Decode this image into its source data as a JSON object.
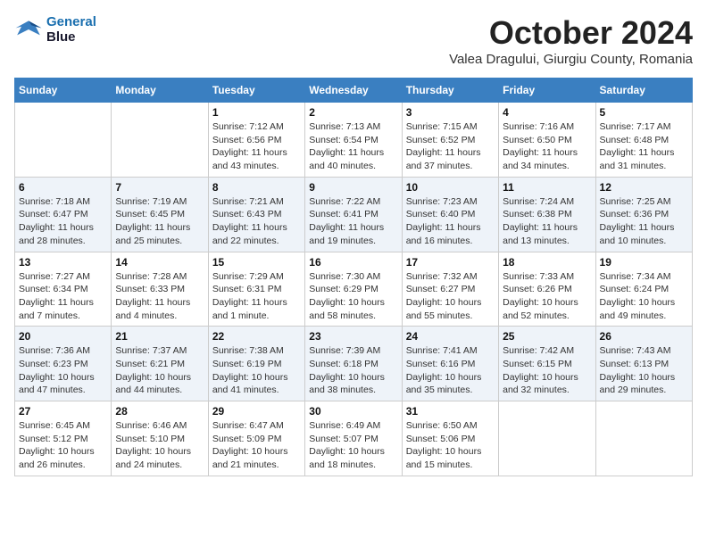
{
  "header": {
    "logo_line1": "General",
    "logo_line2": "Blue",
    "month": "October 2024",
    "location": "Valea Dragului, Giurgiu County, Romania"
  },
  "weekdays": [
    "Sunday",
    "Monday",
    "Tuesday",
    "Wednesday",
    "Thursday",
    "Friday",
    "Saturday"
  ],
  "weeks": [
    [
      {
        "day": "",
        "sunrise": "",
        "sunset": "",
        "daylight": ""
      },
      {
        "day": "",
        "sunrise": "",
        "sunset": "",
        "daylight": ""
      },
      {
        "day": "1",
        "sunrise": "Sunrise: 7:12 AM",
        "sunset": "Sunset: 6:56 PM",
        "daylight": "Daylight: 11 hours and 43 minutes."
      },
      {
        "day": "2",
        "sunrise": "Sunrise: 7:13 AM",
        "sunset": "Sunset: 6:54 PM",
        "daylight": "Daylight: 11 hours and 40 minutes."
      },
      {
        "day": "3",
        "sunrise": "Sunrise: 7:15 AM",
        "sunset": "Sunset: 6:52 PM",
        "daylight": "Daylight: 11 hours and 37 minutes."
      },
      {
        "day": "4",
        "sunrise": "Sunrise: 7:16 AM",
        "sunset": "Sunset: 6:50 PM",
        "daylight": "Daylight: 11 hours and 34 minutes."
      },
      {
        "day": "5",
        "sunrise": "Sunrise: 7:17 AM",
        "sunset": "Sunset: 6:48 PM",
        "daylight": "Daylight: 11 hours and 31 minutes."
      }
    ],
    [
      {
        "day": "6",
        "sunrise": "Sunrise: 7:18 AM",
        "sunset": "Sunset: 6:47 PM",
        "daylight": "Daylight: 11 hours and 28 minutes."
      },
      {
        "day": "7",
        "sunrise": "Sunrise: 7:19 AM",
        "sunset": "Sunset: 6:45 PM",
        "daylight": "Daylight: 11 hours and 25 minutes."
      },
      {
        "day": "8",
        "sunrise": "Sunrise: 7:21 AM",
        "sunset": "Sunset: 6:43 PM",
        "daylight": "Daylight: 11 hours and 22 minutes."
      },
      {
        "day": "9",
        "sunrise": "Sunrise: 7:22 AM",
        "sunset": "Sunset: 6:41 PM",
        "daylight": "Daylight: 11 hours and 19 minutes."
      },
      {
        "day": "10",
        "sunrise": "Sunrise: 7:23 AM",
        "sunset": "Sunset: 6:40 PM",
        "daylight": "Daylight: 11 hours and 16 minutes."
      },
      {
        "day": "11",
        "sunrise": "Sunrise: 7:24 AM",
        "sunset": "Sunset: 6:38 PM",
        "daylight": "Daylight: 11 hours and 13 minutes."
      },
      {
        "day": "12",
        "sunrise": "Sunrise: 7:25 AM",
        "sunset": "Sunset: 6:36 PM",
        "daylight": "Daylight: 11 hours and 10 minutes."
      }
    ],
    [
      {
        "day": "13",
        "sunrise": "Sunrise: 7:27 AM",
        "sunset": "Sunset: 6:34 PM",
        "daylight": "Daylight: 11 hours and 7 minutes."
      },
      {
        "day": "14",
        "sunrise": "Sunrise: 7:28 AM",
        "sunset": "Sunset: 6:33 PM",
        "daylight": "Daylight: 11 hours and 4 minutes."
      },
      {
        "day": "15",
        "sunrise": "Sunrise: 7:29 AM",
        "sunset": "Sunset: 6:31 PM",
        "daylight": "Daylight: 11 hours and 1 minute."
      },
      {
        "day": "16",
        "sunrise": "Sunrise: 7:30 AM",
        "sunset": "Sunset: 6:29 PM",
        "daylight": "Daylight: 10 hours and 58 minutes."
      },
      {
        "day": "17",
        "sunrise": "Sunrise: 7:32 AM",
        "sunset": "Sunset: 6:27 PM",
        "daylight": "Daylight: 10 hours and 55 minutes."
      },
      {
        "day": "18",
        "sunrise": "Sunrise: 7:33 AM",
        "sunset": "Sunset: 6:26 PM",
        "daylight": "Daylight: 10 hours and 52 minutes."
      },
      {
        "day": "19",
        "sunrise": "Sunrise: 7:34 AM",
        "sunset": "Sunset: 6:24 PM",
        "daylight": "Daylight: 10 hours and 49 minutes."
      }
    ],
    [
      {
        "day": "20",
        "sunrise": "Sunrise: 7:36 AM",
        "sunset": "Sunset: 6:23 PM",
        "daylight": "Daylight: 10 hours and 47 minutes."
      },
      {
        "day": "21",
        "sunrise": "Sunrise: 7:37 AM",
        "sunset": "Sunset: 6:21 PM",
        "daylight": "Daylight: 10 hours and 44 minutes."
      },
      {
        "day": "22",
        "sunrise": "Sunrise: 7:38 AM",
        "sunset": "Sunset: 6:19 PM",
        "daylight": "Daylight: 10 hours and 41 minutes."
      },
      {
        "day": "23",
        "sunrise": "Sunrise: 7:39 AM",
        "sunset": "Sunset: 6:18 PM",
        "daylight": "Daylight: 10 hours and 38 minutes."
      },
      {
        "day": "24",
        "sunrise": "Sunrise: 7:41 AM",
        "sunset": "Sunset: 6:16 PM",
        "daylight": "Daylight: 10 hours and 35 minutes."
      },
      {
        "day": "25",
        "sunrise": "Sunrise: 7:42 AM",
        "sunset": "Sunset: 6:15 PM",
        "daylight": "Daylight: 10 hours and 32 minutes."
      },
      {
        "day": "26",
        "sunrise": "Sunrise: 7:43 AM",
        "sunset": "Sunset: 6:13 PM",
        "daylight": "Daylight: 10 hours and 29 minutes."
      }
    ],
    [
      {
        "day": "27",
        "sunrise": "Sunrise: 6:45 AM",
        "sunset": "Sunset: 5:12 PM",
        "daylight": "Daylight: 10 hours and 26 minutes."
      },
      {
        "day": "28",
        "sunrise": "Sunrise: 6:46 AM",
        "sunset": "Sunset: 5:10 PM",
        "daylight": "Daylight: 10 hours and 24 minutes."
      },
      {
        "day": "29",
        "sunrise": "Sunrise: 6:47 AM",
        "sunset": "Sunset: 5:09 PM",
        "daylight": "Daylight: 10 hours and 21 minutes."
      },
      {
        "day": "30",
        "sunrise": "Sunrise: 6:49 AM",
        "sunset": "Sunset: 5:07 PM",
        "daylight": "Daylight: 10 hours and 18 minutes."
      },
      {
        "day": "31",
        "sunrise": "Sunrise: 6:50 AM",
        "sunset": "Sunset: 5:06 PM",
        "daylight": "Daylight: 10 hours and 15 minutes."
      },
      {
        "day": "",
        "sunrise": "",
        "sunset": "",
        "daylight": ""
      },
      {
        "day": "",
        "sunrise": "",
        "sunset": "",
        "daylight": ""
      }
    ]
  ]
}
